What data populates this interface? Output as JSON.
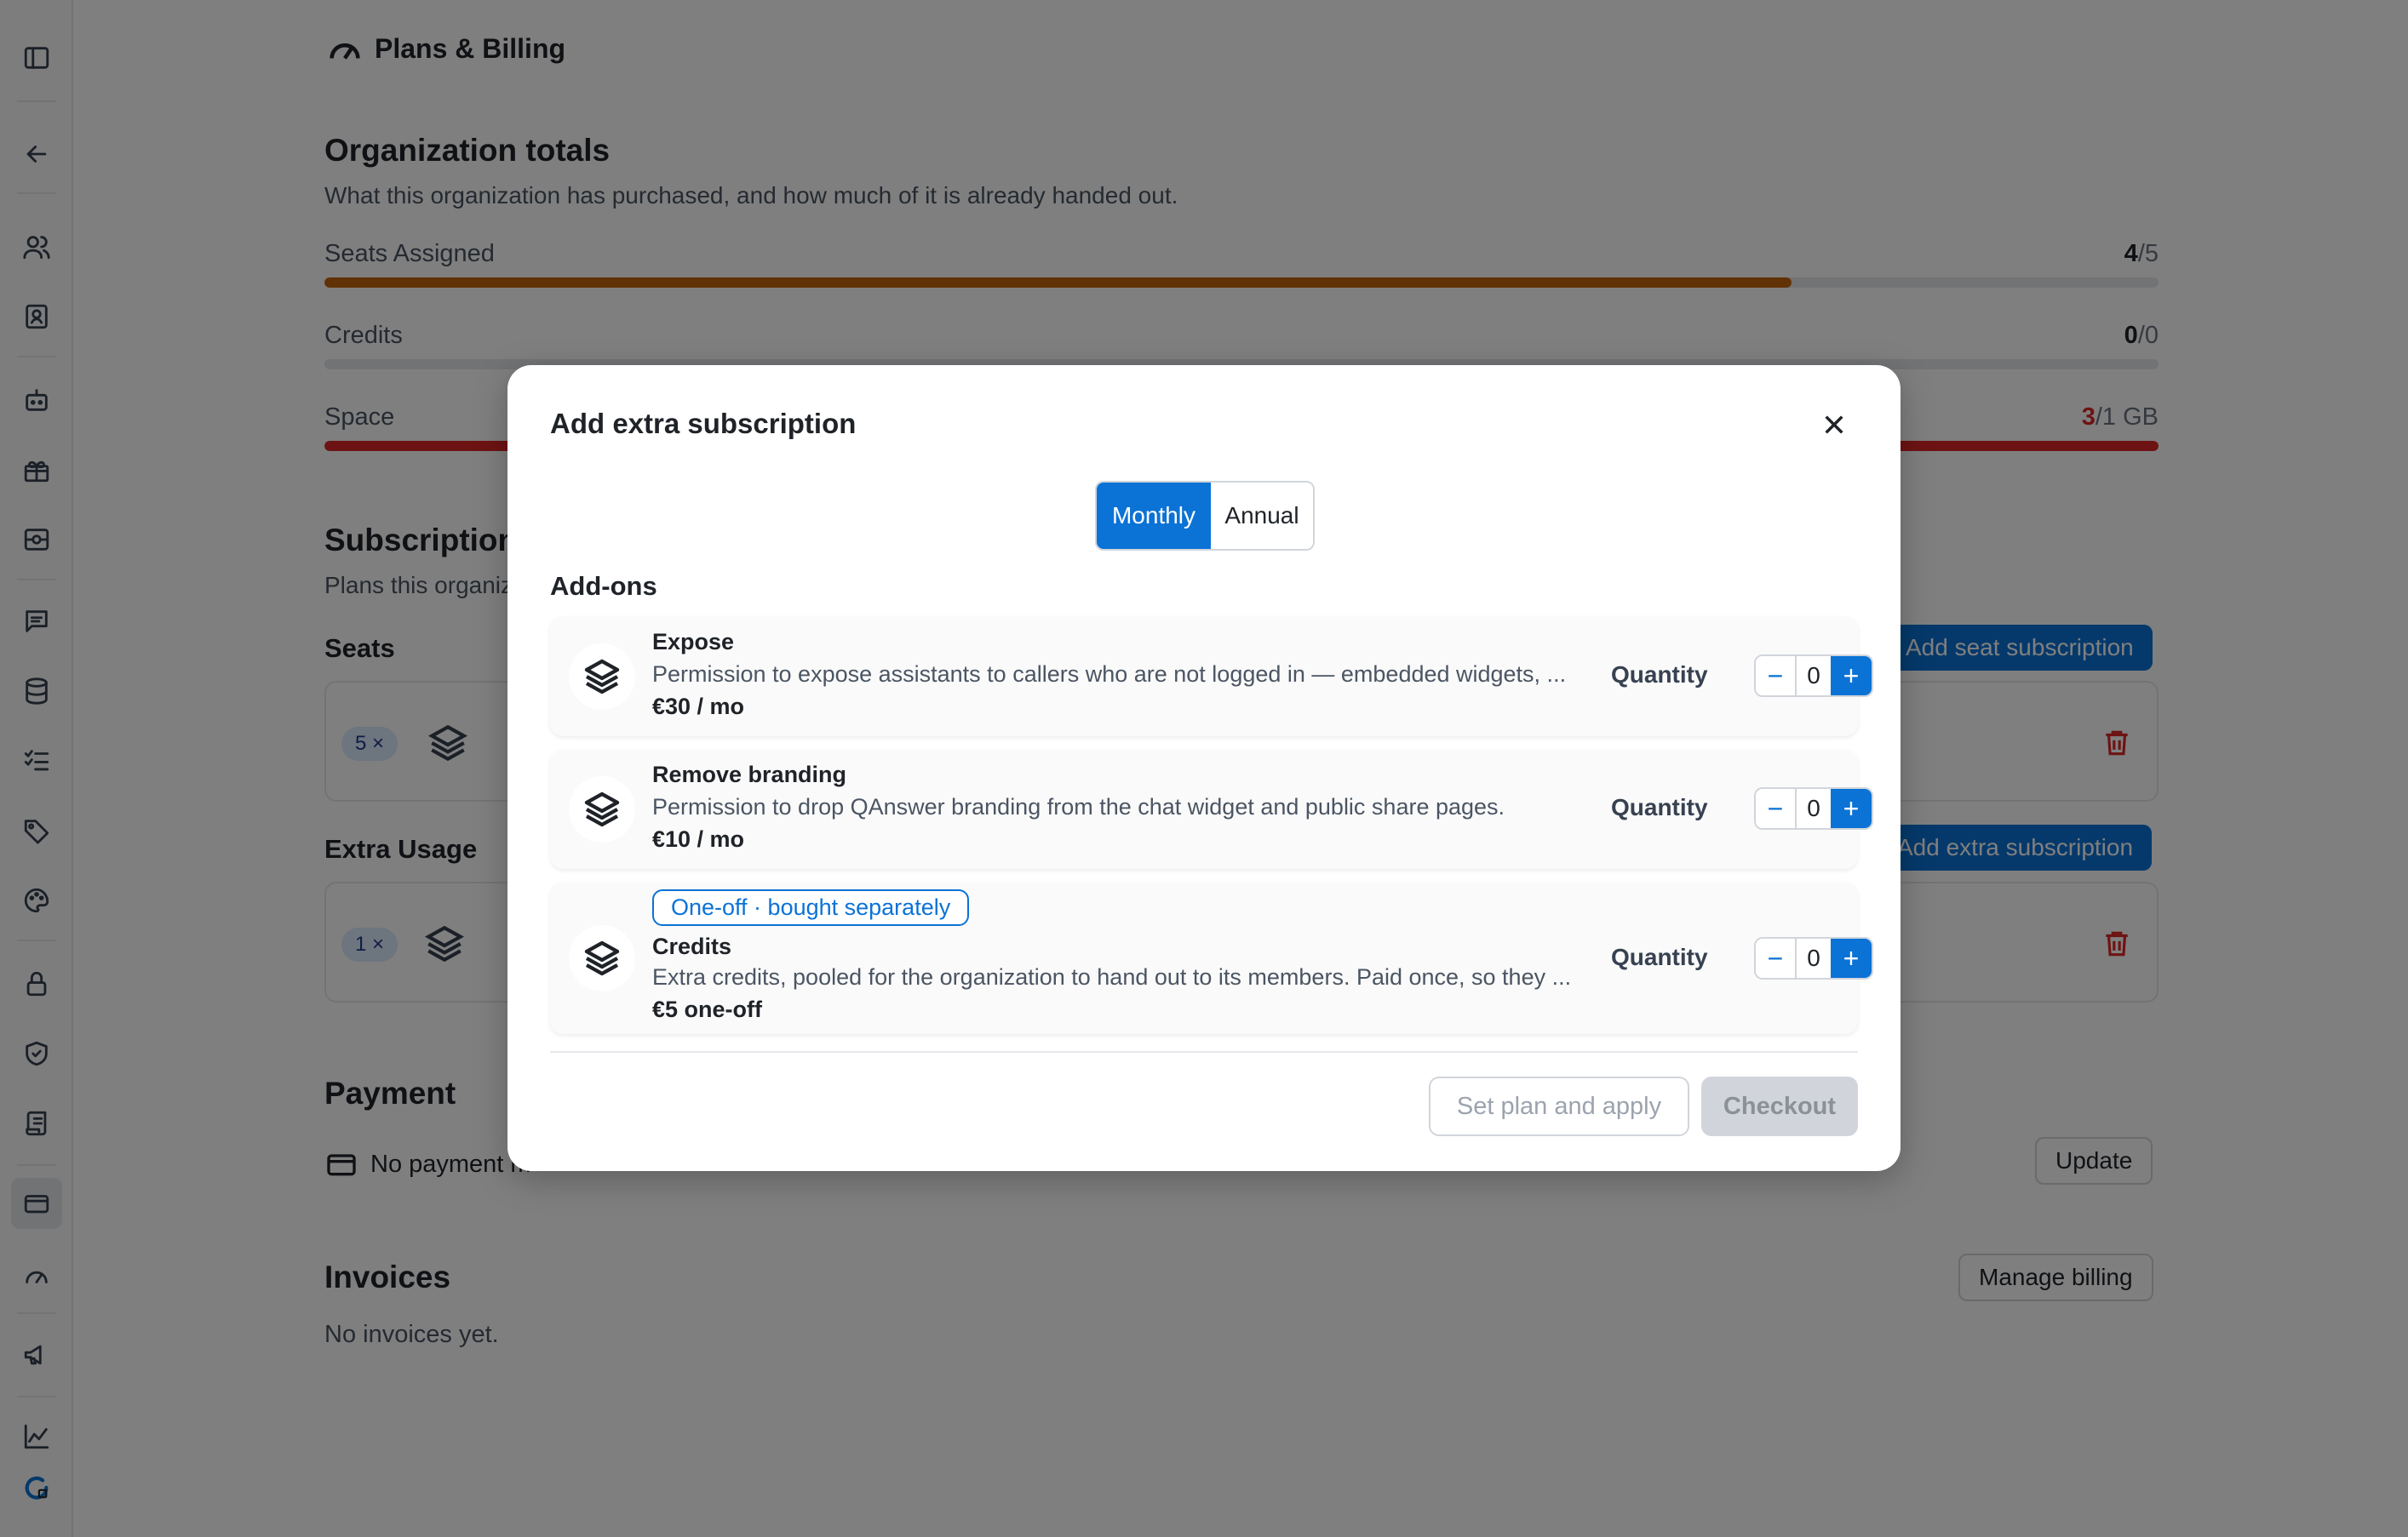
{
  "page": {
    "title": "Plans & Billing"
  },
  "org_totals": {
    "title": "Organization totals",
    "subtitle": "What this organization has purchased, and how much of it is already handed out.",
    "meters": [
      {
        "label": "Seats Assigned",
        "used": "4",
        "total": "/5",
        "fill_fraction": 0.8,
        "color": "#c2640a"
      },
      {
        "label": "Credits",
        "used": "0",
        "total": "/0",
        "fill_fraction": 0,
        "color": "#c2640a"
      },
      {
        "label": "Space",
        "used": "3",
        "total": "/1 GB",
        "fill_fraction": 1,
        "color": "#dc2626"
      }
    ]
  },
  "subscriptions": {
    "title": "Subscriptions",
    "subtitle": "Plans this organization",
    "seats_label": "Seats",
    "seats_qty": "5 ×",
    "add_seat_label": "Add seat subscription",
    "extra_label": "Extra Usage",
    "extra_qty": "1 ×",
    "add_extra_label": "Add extra subscription"
  },
  "payment": {
    "title": "Payment",
    "method_text": "No payment m",
    "update_label": "Update"
  },
  "invoices": {
    "title": "Invoices",
    "empty_text": "No invoices yet.",
    "manage_label": "Manage billing"
  },
  "modal": {
    "title": "Add extra subscription",
    "billing_options": [
      "Monthly",
      "Annual"
    ],
    "selected_billing": "Monthly",
    "addons_title": "Add-ons",
    "quantity_label": "Quantity",
    "addons": [
      {
        "name": "Expose",
        "description": "Permission to expose assistants to callers who are not logged in — embedded widgets, ...",
        "price": "€30 / mo",
        "quantity": "0"
      },
      {
        "name": "Remove branding",
        "description": "Permission to drop QAnswer branding from the chat widget and public share pages.",
        "price": "€10 / mo",
        "quantity": "0"
      },
      {
        "badge": "One-off · bought separately",
        "name": "Credits",
        "description": "Extra credits, pooled for the organization to hand out to its members. Paid once, so they ...",
        "price": "€5 one-off",
        "quantity": "0"
      }
    ],
    "set_plan_label": "Set plan and apply",
    "checkout_label": "Checkout"
  },
  "colors": {
    "accent": "#0b72d6",
    "warning": "#c2640a",
    "danger": "#dc2626"
  }
}
